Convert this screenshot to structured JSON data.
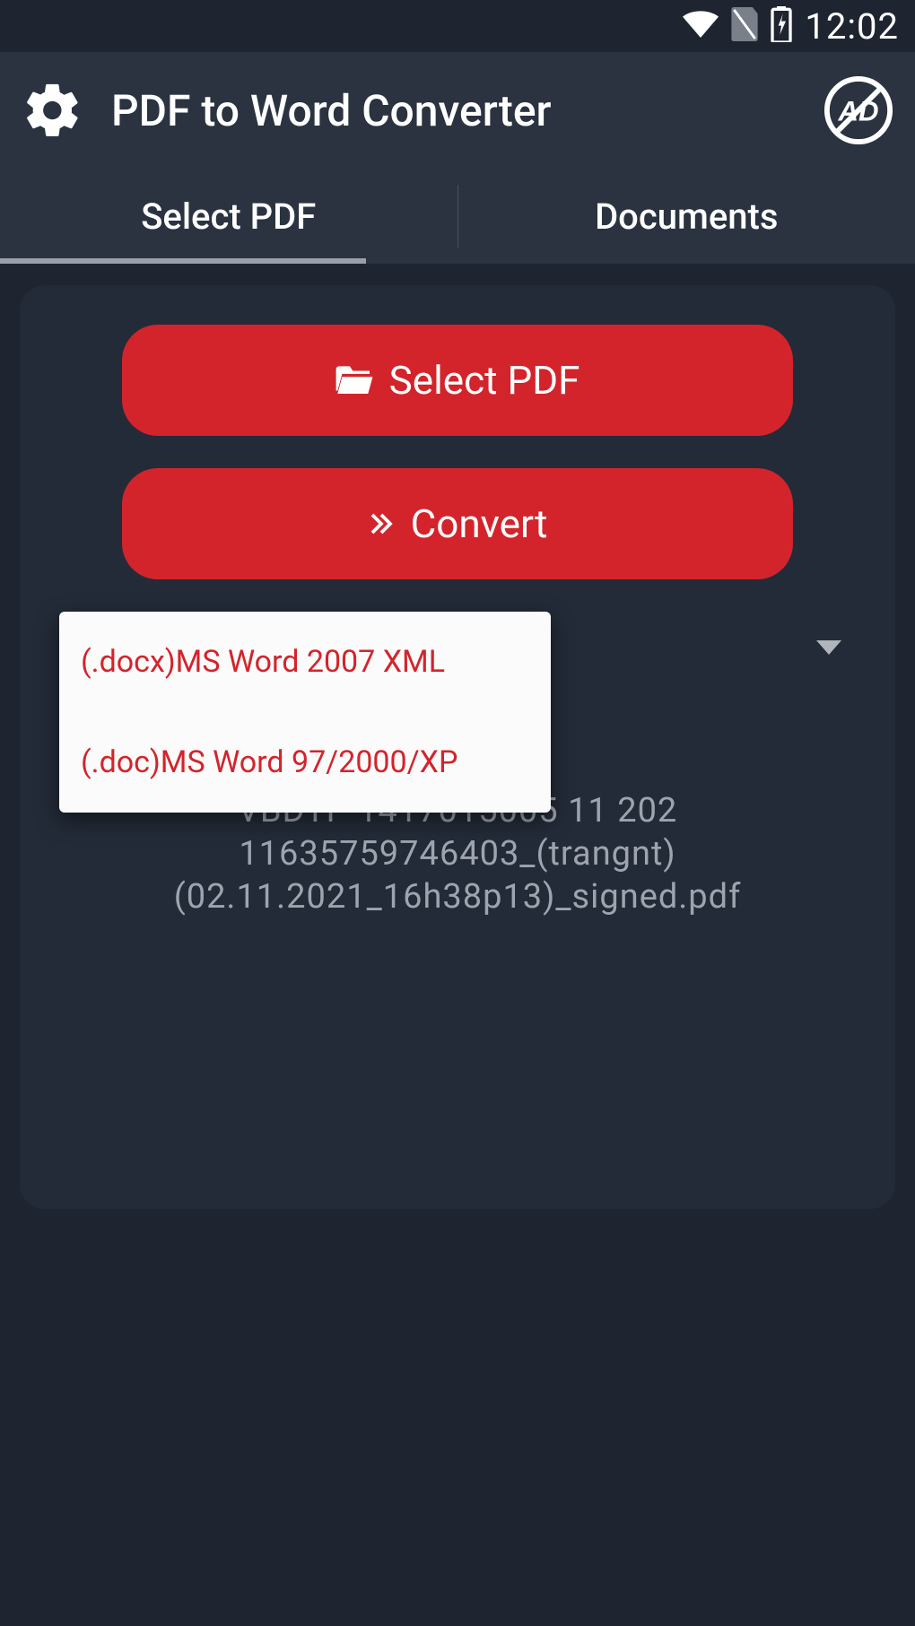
{
  "status": {
    "time": "12:02"
  },
  "header": {
    "title": "PDF to Word Converter"
  },
  "tabs": {
    "select_pdf": "Select PDF",
    "documents": "Documents"
  },
  "main": {
    "select_pdf_button": "Select PDF",
    "convert_button": "Convert",
    "filename_line1": "VBDTP 1417015005 11 202",
    "filename_line2": "11635759746403_(trangnt)",
    "filename_line3": "(02.11.2021_16h38p13)_signed.pdf"
  },
  "dropdown": {
    "option_docx": "(.docx)MS Word 2007 XML",
    "option_doc": "(.doc)MS Word 97/2000/XP"
  }
}
